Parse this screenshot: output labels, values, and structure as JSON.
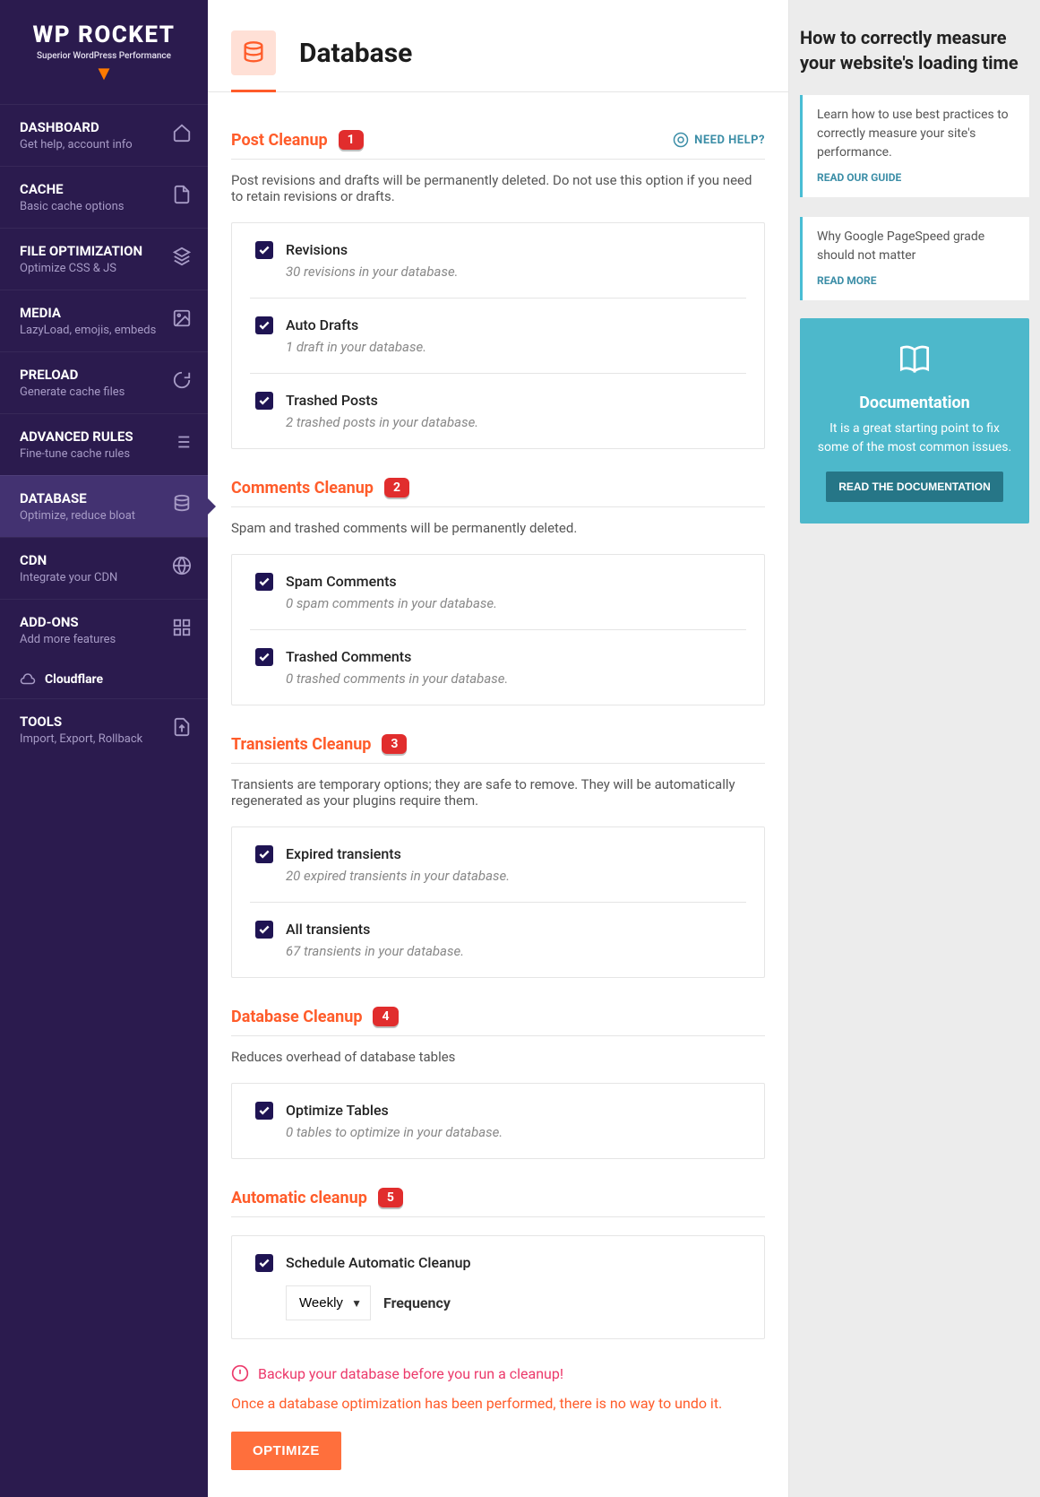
{
  "logo": {
    "main": "WP ROCKET",
    "sub": "Superior WordPress Performance"
  },
  "nav": [
    {
      "title": "DASHBOARD",
      "desc": "Get help, account info"
    },
    {
      "title": "CACHE",
      "desc": "Basic cache options"
    },
    {
      "title": "FILE OPTIMIZATION",
      "desc": "Optimize CSS & JS"
    },
    {
      "title": "MEDIA",
      "desc": "LazyLoad, emojis, embeds"
    },
    {
      "title": "PRELOAD",
      "desc": "Generate cache files"
    },
    {
      "title": "ADVANCED RULES",
      "desc": "Fine-tune cache rules"
    },
    {
      "title": "DATABASE",
      "desc": "Optimize, reduce bloat"
    },
    {
      "title": "CDN",
      "desc": "Integrate your CDN"
    },
    {
      "title": "ADD-ONS",
      "desc": "Add more features"
    }
  ],
  "cloudflare_label": "Cloudflare",
  "nav_tools": {
    "title": "TOOLS",
    "desc": "Import, Export, Rollback"
  },
  "page": {
    "title": "Database"
  },
  "need_help": "NEED HELP?",
  "sections": [
    {
      "title": "Post Cleanup",
      "tag": "1",
      "desc": "Post revisions and drafts will be permanently deleted. Do not use this option if you need to retain revisions or drafts.",
      "show_help": true,
      "options": [
        {
          "label": "Revisions",
          "sub": "30 revisions in your database."
        },
        {
          "label": "Auto Drafts",
          "sub": "1 draft in your database."
        },
        {
          "label": "Trashed Posts",
          "sub": "2 trashed posts in your database."
        }
      ]
    },
    {
      "title": "Comments Cleanup",
      "tag": "2",
      "desc": "Spam and trashed comments will be permanently deleted.",
      "options": [
        {
          "label": "Spam Comments",
          "sub": "0 spam comments in your database."
        },
        {
          "label": "Trashed Comments",
          "sub": "0 trashed comments in your database."
        }
      ]
    },
    {
      "title": "Transients Cleanup",
      "tag": "3",
      "desc": "Transients are temporary options; they are safe to remove. They will be automatically regenerated as your plugins require them.",
      "options": [
        {
          "label": "Expired transients",
          "sub": "20 expired transients in your database."
        },
        {
          "label": "All transients",
          "sub": "67 transients in your database."
        }
      ]
    },
    {
      "title": "Database Cleanup",
      "tag": "4",
      "desc": "Reduces overhead of database tables",
      "options": [
        {
          "label": "Optimize Tables",
          "sub": "0 tables to optimize in your database."
        }
      ]
    },
    {
      "title": "Automatic cleanup",
      "tag": "5",
      "options": [
        {
          "label": "Schedule Automatic Cleanup",
          "select": "Weekly",
          "select_label": "Frequency"
        }
      ]
    }
  ],
  "warning1": "Backup your database before you run a cleanup!",
  "warning2": "Once a database optimization has been performed, there is no way to undo it.",
  "optimize_btn": "OPTIMIZE",
  "right": {
    "heading": "How to correctly measure your website's loading time",
    "cards": [
      {
        "text": "Learn how to use best practices to correctly measure your site's performance.",
        "link": "READ OUR GUIDE"
      },
      {
        "text": "Why Google PageSpeed grade should not matter",
        "link": "READ MORE"
      }
    ],
    "doc": {
      "title": "Documentation",
      "text": "It is a great starting point to fix some of the most common issues.",
      "btn": "READ THE DOCUMENTATION"
    }
  }
}
